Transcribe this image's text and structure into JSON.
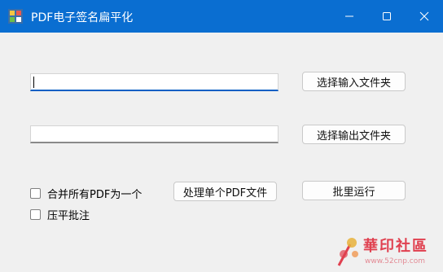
{
  "window": {
    "title": "PDF电子签名扁平化",
    "icon": "app-icon",
    "controls": [
      "minimize-icon",
      "maximize-icon",
      "close-icon"
    ],
    "accent_color": "#0a6ed1"
  },
  "form": {
    "input_path": {
      "value": "",
      "placeholder": ""
    },
    "output_path": {
      "value": "",
      "placeholder": ""
    },
    "select_input_label": "选择输入文件夹",
    "select_output_label": "选择输出文件夹",
    "merge_checkbox": {
      "label": "合并所有PDF为一个",
      "checked": false
    },
    "flatten_annot_checkbox": {
      "label": "压平批注",
      "checked": false
    },
    "process_single_label": "处理单个PDF文件",
    "batch_run_label": "批里运行"
  },
  "watermark": {
    "text": "華印社區",
    "url": "www.52cnp.com",
    "icon": "pen-flower-logo",
    "color": "#e0404f"
  }
}
